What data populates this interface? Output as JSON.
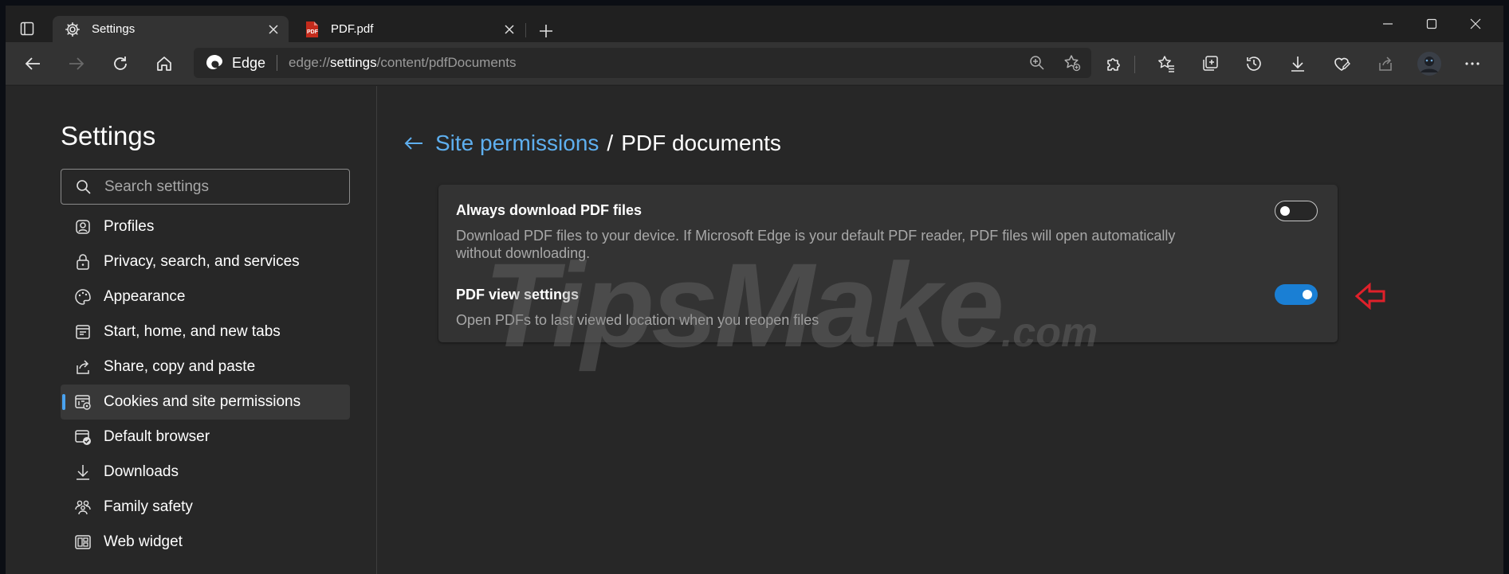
{
  "tabs": [
    {
      "title": "Settings",
      "icon": "gear-icon",
      "active": true
    },
    {
      "title": "PDF.pdf",
      "icon": "pdf-file-icon",
      "active": false
    }
  ],
  "addressbar": {
    "site": "Edge",
    "url_prefix": "edge://",
    "url_host": "settings",
    "url_path": "/content/pdfDocuments"
  },
  "sidebar": {
    "title": "Settings",
    "search_placeholder": "Search settings",
    "items": [
      {
        "label": "Profiles",
        "icon": "profile-icon"
      },
      {
        "label": "Privacy, search, and services",
        "icon": "lock-icon"
      },
      {
        "label": "Appearance",
        "icon": "palette-icon"
      },
      {
        "label": "Start, home, and new tabs",
        "icon": "start-page-icon"
      },
      {
        "label": "Share, copy and paste",
        "icon": "share-icon"
      },
      {
        "label": "Cookies and site permissions",
        "icon": "site-permissions-icon",
        "selected": true
      },
      {
        "label": "Default browser",
        "icon": "default-browser-icon"
      },
      {
        "label": "Downloads",
        "icon": "download-icon"
      },
      {
        "label": "Family safety",
        "icon": "family-icon"
      },
      {
        "label": "Web widget",
        "icon": "widget-icon"
      }
    ]
  },
  "main": {
    "breadcrumb_link": "Site permissions",
    "breadcrumb_separator": "/",
    "breadcrumb_current": "PDF documents",
    "settings": [
      {
        "title": "Always download PDF files",
        "description": "Download PDF files to your device. If Microsoft Edge is your default PDF reader, PDF files will open automatically without downloading.",
        "enabled": false
      },
      {
        "title": "PDF view settings",
        "description": "Open PDFs to last viewed location when you reopen files",
        "enabled": true
      }
    ]
  },
  "watermark": {
    "text": "TipsMake",
    "suffix": ".com"
  },
  "colors": {
    "accent": "#1a7fd4",
    "link": "#5eafef",
    "annotation_arrow": "#e0202a"
  }
}
